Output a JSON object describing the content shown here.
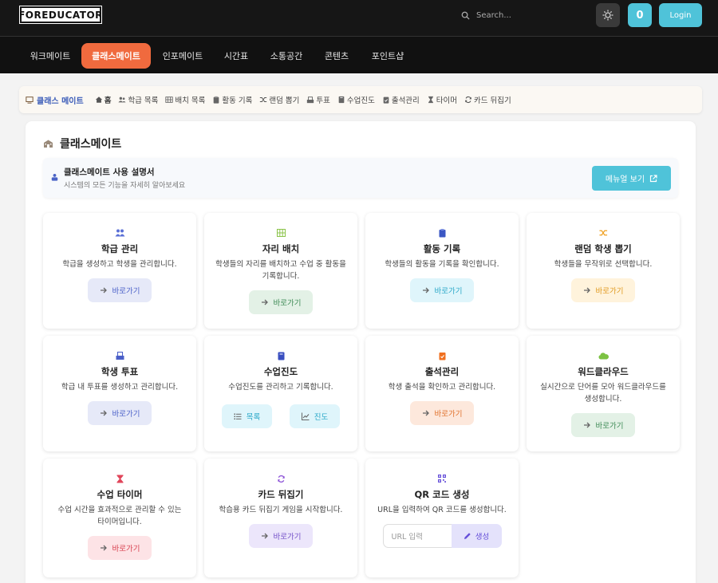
{
  "header": {
    "logo_text": "FOREDUCATOR",
    "search_placeholder": "Search...",
    "count_badge": "0",
    "login_label": "Login"
  },
  "nav": {
    "items": [
      {
        "label": "워크메이트"
      },
      {
        "label": "클래스메이트"
      },
      {
        "label": "인포메이트"
      },
      {
        "label": "시간표"
      },
      {
        "label": "소통공간"
      },
      {
        "label": "콘텐츠"
      },
      {
        "label": "포인트샵"
      }
    ],
    "active": "클래스메이트"
  },
  "breadcrumb": {
    "brand": "클래스 메이트",
    "items": [
      {
        "label": "홈",
        "icon": "home-icon"
      },
      {
        "label": "학급 목록",
        "icon": "users-icon"
      },
      {
        "label": "배치 목록",
        "icon": "grid-icon"
      },
      {
        "label": "활동 기록",
        "icon": "clipboard-icon"
      },
      {
        "label": "랜덤 뽑기",
        "icon": "shuffle-icon"
      },
      {
        "label": "투표",
        "icon": "vote-icon"
      },
      {
        "label": "수업진도",
        "icon": "book-icon"
      },
      {
        "label": "출석관리",
        "icon": "clipboard-check-icon"
      },
      {
        "label": "타이머",
        "icon": "hourglass-icon"
      },
      {
        "label": "카드 뒤집기",
        "icon": "refresh-icon"
      }
    ]
  },
  "page": {
    "title": "클래스메이트",
    "manual_title": "클래스메이트 사용 설명서",
    "manual_desc": "시스템의 모든 기능을 자세히 알아보세요",
    "manual_button": "메뉴얼 보기"
  },
  "cards": [
    {
      "title": "학급 관리",
      "desc": "학급을 생성하고 학생을 관리합니다.",
      "button": "바로가기",
      "icon": "users-icon",
      "accent": "#5a6fd6"
    },
    {
      "title": "자리 배치",
      "desc": "학생들의 자리를 배치하고 수업 중 활동을 기록합니다.",
      "button": "바로가기",
      "icon": "grid-icon",
      "accent": "#8bc34a"
    },
    {
      "title": "활동 기록",
      "desc": "학생들의 활동을 기록을 확인합니다.",
      "button": "바로가기",
      "icon": "clipboard-icon",
      "accent": "#3b57c4"
    },
    {
      "title": "랜덤 학생 뽑기",
      "desc": "학생들을 무작위로 선택합니다.",
      "button": "바로가기",
      "icon": "shuffle-icon",
      "accent": "#f0a020"
    },
    {
      "title": "학생 투표",
      "desc": "학급 내 투표를 생성하고 관리합니다.",
      "button": "바로가기",
      "icon": "vote-icon",
      "accent": "#4a5fc8"
    },
    {
      "title": "수업진도",
      "desc": "수업진도를 관리하고 기록합니다.",
      "buttons": [
        "목록",
        "진도"
      ],
      "icon": "book-icon",
      "accent": "#3a4fc0"
    },
    {
      "title": "출석관리",
      "desc": "학생 출석을 확인하고 관리합니다.",
      "button": "바로가기",
      "icon": "clipboard-check-icon",
      "accent": "#f07020"
    },
    {
      "title": "워드클라우드",
      "desc": "실시간으로 단어를 모아 워드클라우드를 생성합니다.",
      "button": "바로가기",
      "icon": "cloud-icon",
      "accent": "#7cc242"
    },
    {
      "title": "수업 타이머",
      "desc": "수업 시간을 효과적으로 관리할 수 있는 타이머입니다.",
      "button": "바로가기",
      "icon": "hourglass-icon",
      "accent": "#e0455a"
    },
    {
      "title": "카드 뒤집기",
      "desc": "학습용 카드 뒤집기 게임을 시작합니다.",
      "button": "바로가기",
      "icon": "refresh-icon",
      "accent": "#8a4fd6"
    },
    {
      "title": "QR 코드 생성",
      "desc": "URL을 입력하여 QR 코드를 생성합니다.",
      "input_placeholder": "URL 입력",
      "button": "생성",
      "icon": "qr-icon",
      "accent": "#6650d9"
    }
  ],
  "colors": {
    "accent_cyan": "#4fc3d9",
    "active_nav": "#f06a3e",
    "brand_blue": "#3a5bb8"
  }
}
